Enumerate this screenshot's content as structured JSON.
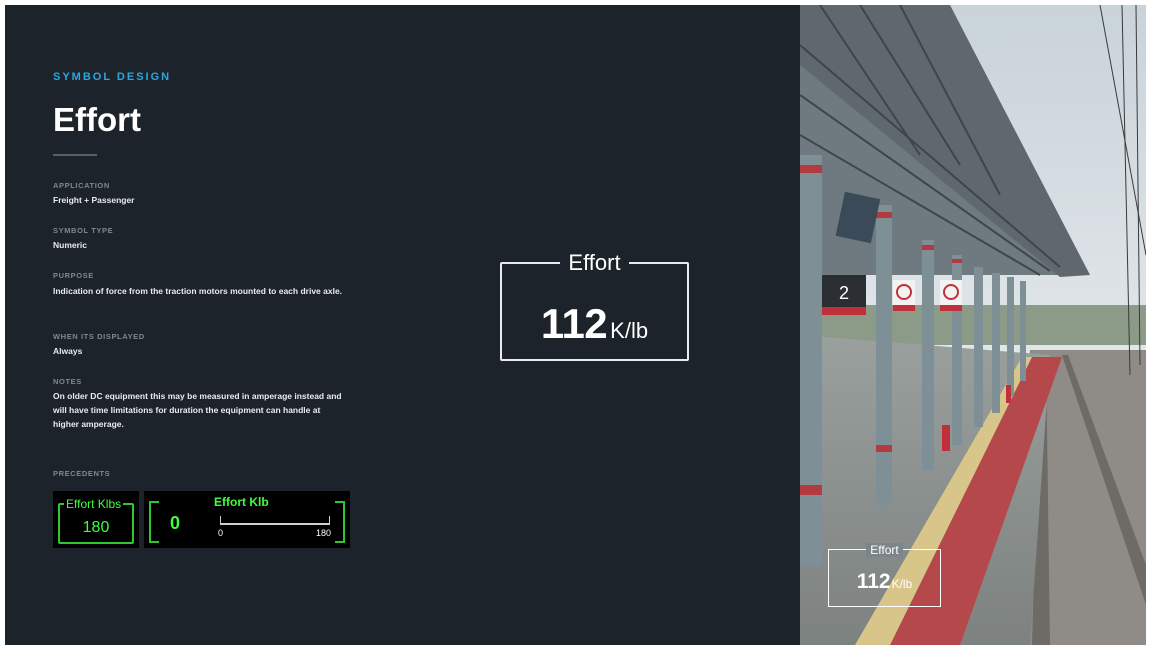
{
  "header": {
    "eyebrow": "SYMBOL DESIGN",
    "title": "Effort"
  },
  "sections": {
    "application": {
      "label": "APPLICATION",
      "value": "Freight + Passenger"
    },
    "symbol_type": {
      "label": "SYMBOL TYPE",
      "value": "Numeric"
    },
    "purpose": {
      "label": "PURPOSE",
      "value": "Indication of force from the traction motors mounted to each drive axle."
    },
    "when_displayed": {
      "label": "WHEN ITS DISPLAYED",
      "value": "Always"
    },
    "notes": {
      "label": "NOTES",
      "value": "On older DC equipment this may be measured in amperage instead and will have time limitations for duration the equipment can handle at higher amperage."
    },
    "precedents": {
      "label": "PRECEDENTS"
    }
  },
  "precedents": {
    "first": {
      "label": "Effort Klbs",
      "value": "180"
    },
    "second": {
      "label": "Effort Klb",
      "value": "0",
      "min": "0",
      "max": "180"
    }
  },
  "symbol": {
    "label": "Effort",
    "value": "112",
    "unit": "K/lb"
  },
  "photo_overlay": {
    "label": "Effort",
    "value": "112",
    "unit": "K/lb"
  },
  "photo_signs": {
    "platform_number": "2"
  },
  "colors": {
    "background": "#1d232a",
    "accent": "#2aa6e0",
    "display_green": "#3dff3d"
  }
}
